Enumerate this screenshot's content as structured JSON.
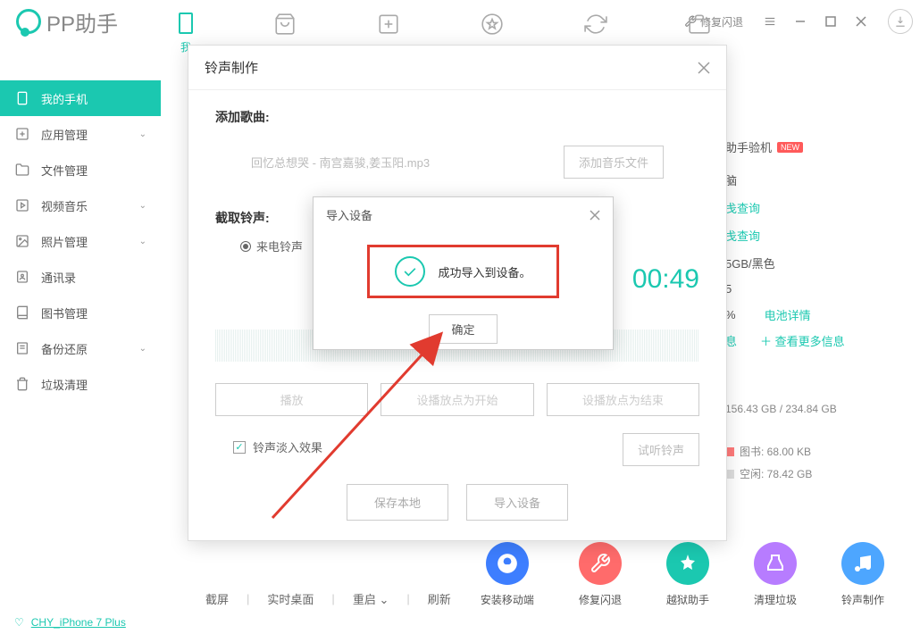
{
  "titlebar": {
    "logo_text": "PP助手",
    "repair_crash": "修复闪退"
  },
  "device_tab_label": "我",
  "sidebar": {
    "items": [
      {
        "label": "我的手机"
      },
      {
        "label": "应用管理"
      },
      {
        "label": "文件管理"
      },
      {
        "label": "视频音乐"
      },
      {
        "label": "照片管理"
      },
      {
        "label": "通讯录"
      },
      {
        "label": "图书管理"
      },
      {
        "label": "备份还原"
      },
      {
        "label": "垃圾清理"
      }
    ]
  },
  "right_panel": {
    "title": "助手验机",
    "badge": "NEW",
    "row1": "脑",
    "row2": "戋查询",
    "row3": "戋查询",
    "row4": "5GB/黑色",
    "row5": "5",
    "percent": "%",
    "battery_link": "电池详情",
    "info_link_suffix": "息",
    "more_link": "查看更多信息",
    "storage": "156.43 GB / 234.84 GB",
    "books": "图书: 68.00 KB",
    "free": "空闲: 78.42 GB"
  },
  "bottom_bar": {
    "screenshot": "截屏",
    "realtime": "实时桌面",
    "reboot": "重启",
    "refresh": "刷新"
  },
  "tools": [
    {
      "label": "安装移动端",
      "color": "#3d7eff"
    },
    {
      "label": "修复闪退",
      "color": "#ff6b6b"
    },
    {
      "label": "越狱助手",
      "color": "#1bc8b0"
    },
    {
      "label": "清理垃圾",
      "color": "#b77cff"
    },
    {
      "label": "铃声制作",
      "color": "#4da6ff"
    }
  ],
  "status": {
    "device": "CHY_iPhone 7 Plus"
  },
  "dialog": {
    "title": "铃声制作",
    "add_song_label": "添加歌曲:",
    "song_name": "回忆总想哭 - 南宫嘉骏,姜玉阳.mp3",
    "add_file_btn": "添加音乐文件",
    "cut_label": "截取铃声:",
    "incoming": "来电铃声",
    "time": "00:49",
    "play": "播放",
    "set_start": "设播放点为开始",
    "set_end": "设播放点为结束",
    "fade": "铃声淡入效果",
    "preview": "试听铃声",
    "save_local": "保存本地",
    "import_device": "导入设备"
  },
  "inner_modal": {
    "title": "导入设备",
    "message": "成功导入到设备。",
    "confirm": "确定"
  }
}
